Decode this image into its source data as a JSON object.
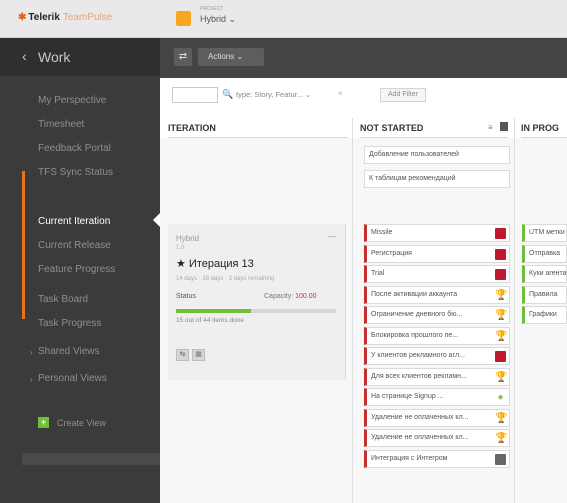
{
  "app": {
    "logo_brand": "Telerik",
    "logo_product": "TeamPulse",
    "project_caption": "PROJECT",
    "project_name": "Hybrid",
    "project_chevron": "⌄",
    "project_color": "#f5a623"
  },
  "sidebar": {
    "back_glyph": "‹",
    "title": "Work",
    "items": [
      {
        "label": "My Perspective"
      },
      {
        "label": "Timesheet"
      },
      {
        "label": "Feedback Portal"
      },
      {
        "label": "TFS Sync Status"
      },
      {
        "label": "Current Iteration"
      },
      {
        "label": "Current Release"
      },
      {
        "label": "Feature Progress"
      },
      {
        "label": "Task Board"
      },
      {
        "label": "Task Progress"
      },
      {
        "label": "Shared Views"
      },
      {
        "label": "Personal Views"
      }
    ],
    "collapse_glyph": "›",
    "create_glyph": "+",
    "create_label": "Create View",
    "active_color": "#e8731a"
  },
  "toolbar": {
    "grid_glyph": "⇄",
    "actions_label": "Actions ⌄"
  },
  "filter": {
    "search_glyph": "🔍",
    "text": "type: Story, Featur...",
    "chevron": "⌄",
    "clear": "×",
    "add_filter": "Add Filter"
  },
  "columns": {
    "iteration": "ITERATION",
    "not_started": "NOT STARTED",
    "not_started_ctrl": "≡",
    "in_progress": "IN PROG"
  },
  "iteration": {
    "parent": "Hybrid",
    "tag": "1.0",
    "dash": "—",
    "name": "★ Итерация 13",
    "meta": "14 days · 28 days · 2 days remaining",
    "status_label": "Status",
    "capacity_label": "Capacity:",
    "capacity_value": "100.00",
    "progress_pct": 47,
    "count_text": "15 out of 44 items done",
    "icon_a": "↹",
    "icon_b": "▦"
  },
  "cards_top": [
    {
      "label": "Добавление пользователей"
    },
    {
      "label": "К таблицам рекомендаций"
    }
  ],
  "cards_not_started": [
    {
      "label": "Missile",
      "icon": "red"
    },
    {
      "label": "Регистрация",
      "icon": "red"
    },
    {
      "label": "Trial",
      "icon": "red"
    },
    {
      "label": "После активации аккаунта",
      "icon": "trophy"
    },
    {
      "label": "Ограничение дневного бю...",
      "icon": "trophy"
    },
    {
      "label": "Блокировка прошлого пе...",
      "icon": "trophy"
    },
    {
      "label": "У клиентов рекламного агл...",
      "icon": "red"
    },
    {
      "label": "Для всех клиентов рекламн...",
      "icon": "trophy"
    },
    {
      "label": "На странице Signup ...",
      "icon": "leaf"
    },
    {
      "label": "Удаление не оплаченных кл...",
      "icon": "trophy"
    },
    {
      "label": "Удаление не оплаченных кл...",
      "icon": "trophy"
    },
    {
      "label": "Интеграция с Интегром",
      "icon": "grey"
    }
  ],
  "cards_in_progress": [
    {
      "label": "UTM метки"
    },
    {
      "label": "Отправка"
    },
    {
      "label": "Куки агента"
    },
    {
      "label": "Правила"
    },
    {
      "label": "Графики"
    }
  ]
}
